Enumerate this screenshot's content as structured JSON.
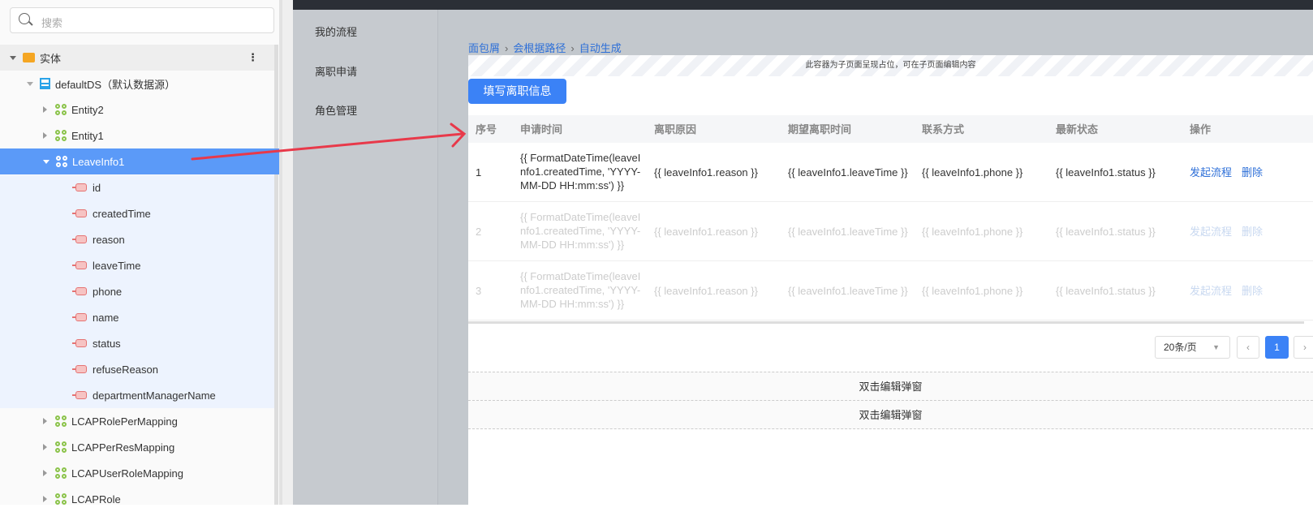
{
  "sidebar": {
    "search_placeholder": "搜索",
    "root": "实体",
    "datasource": "defaultDS（默认数据源）",
    "entities_before": [
      "Entity2",
      "Entity1"
    ],
    "selected": "LeaveInfo1",
    "fields": [
      "id",
      "createdTime",
      "reason",
      "leaveTime",
      "phone",
      "name",
      "status",
      "refuseReason",
      "departmentManagerName"
    ],
    "entities_after": [
      "LCAPRolePerMapping",
      "LCAPPerResMapping",
      "LCAPUserRoleMapping",
      "LCAPRole"
    ]
  },
  "nav": {
    "items": [
      "我的流程",
      "离职申请",
      "角色管理"
    ]
  },
  "breadcrumb": [
    "面包屑",
    "会根据路径",
    "自动生成"
  ],
  "placeholder_note": "此容器为子页面呈现占位，可在子页面编辑内容",
  "fill_button": "填写离职信息",
  "table": {
    "headers": [
      "序号",
      "申请时间",
      "离职原因",
      "期望离职时间",
      "联系方式",
      "最新状态",
      "操作"
    ],
    "rows": [
      {
        "index": "1",
        "created": "{{ FormatDateTime(leaveInfo1.createdTime, 'YYYY-MM-DD HH:mm:ss') }}",
        "reason": "{{ leaveInfo1.reason }}",
        "leaveTime": "{{ leaveInfo1.leaveTime }}",
        "phone": "{{ leaveInfo1.phone }}",
        "status": "{{ leaveInfo1.status }}",
        "action1": "发起流程",
        "action2": "删除"
      },
      {
        "index": "2",
        "created": "{{ FormatDateTime(leaveInfo1.createdTime, 'YYYY-MM-DD HH:mm:ss') }}",
        "reason": "{{ leaveInfo1.reason }}",
        "leaveTime": "{{ leaveInfo1.leaveTime }}",
        "phone": "{{ leaveInfo1.phone }}",
        "status": "{{ leaveInfo1.status }}",
        "action1": "发起流程",
        "action2": "删除"
      },
      {
        "index": "3",
        "created": "{{ FormatDateTime(leaveInfo1.createdTime, 'YYYY-MM-DD HH:mm:ss') }}",
        "reason": "{{ leaveInfo1.reason }}",
        "leaveTime": "{{ leaveInfo1.leaveTime }}",
        "phone": "{{ leaveInfo1.phone }}",
        "status": "{{ leaveInfo1.status }}",
        "action1": "发起流程",
        "action2": "删除"
      }
    ]
  },
  "pagination": {
    "page_size": "20条/页",
    "current_page": "1",
    "prev": "‹",
    "next": "›"
  },
  "dialogs": [
    "双击编辑弹窗",
    "双击编辑弹窗"
  ],
  "colors": {
    "accent": "#3b82f6",
    "selected_row": "#5b9af8",
    "annotation_arrow": "#e8394a"
  }
}
